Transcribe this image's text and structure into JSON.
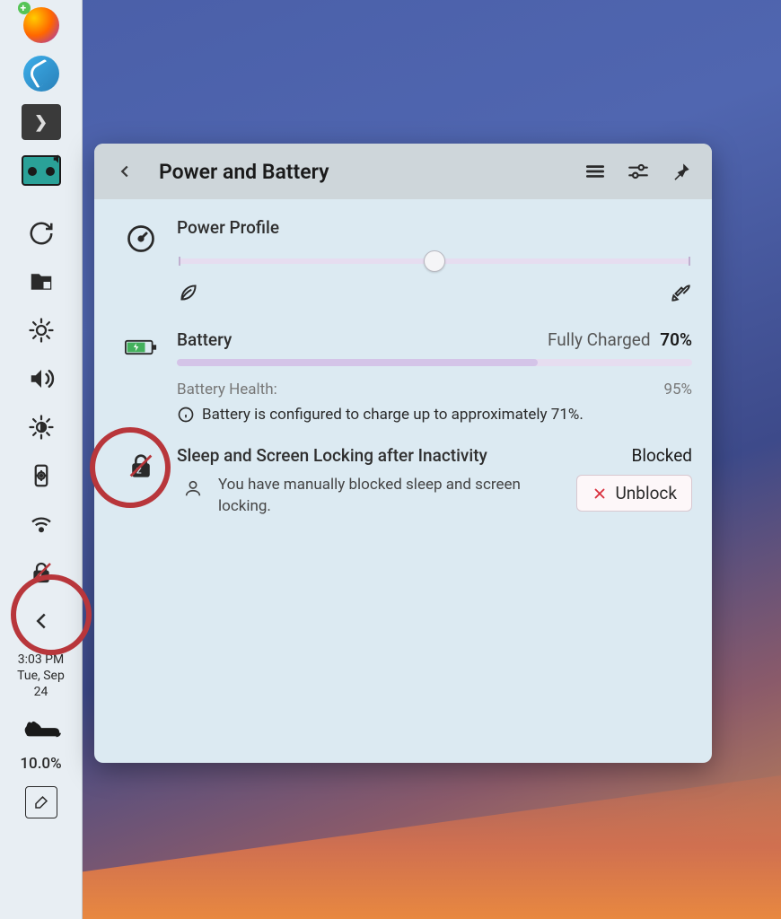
{
  "popup": {
    "title": "Power and Battery",
    "power_profile": {
      "title": "Power Profile"
    },
    "battery": {
      "title": "Battery",
      "status": "Fully Charged",
      "percent": "70%",
      "health_label": "Battery Health:",
      "health_value": "95%",
      "note": "Battery is configured to charge up to approximately 71%."
    },
    "sleep": {
      "title": "Sleep and Screen Locking after Inactivity",
      "status": "Blocked",
      "desc": "You have manually blocked sleep and screen locking.",
      "unblock_label": "Unblock"
    }
  },
  "taskbar": {
    "time": "3:03 PM",
    "day": "Tue, Sep",
    "date": "24",
    "percent": "10.0%"
  }
}
